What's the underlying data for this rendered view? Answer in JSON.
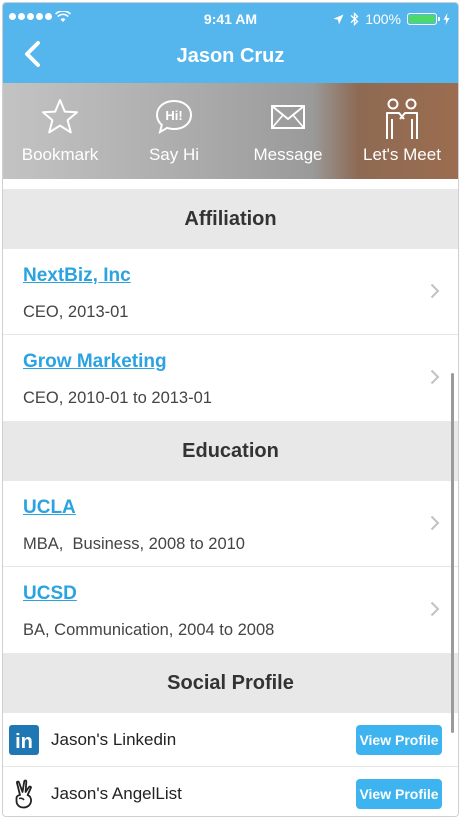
{
  "status_bar": {
    "time": "9:41 AM",
    "battery_pct": "100%"
  },
  "nav": {
    "title": "Jason Cruz"
  },
  "actions": [
    {
      "label": "Bookmark",
      "icon": "star-icon"
    },
    {
      "label": "Say Hi",
      "icon": "say-hi-icon",
      "bubble_text": "Hi!"
    },
    {
      "label": "Message",
      "icon": "envelope-icon"
    },
    {
      "label": "Let's Meet",
      "icon": "handshake-icon"
    }
  ],
  "sections": {
    "affiliation": {
      "title": "Affiliation",
      "items": [
        {
          "name": "NextBiz, Inc",
          "detail": "CEO, 2013-01"
        },
        {
          "name": "Grow Marketing",
          "detail": "CEO, 2010-01 to 2013-01"
        }
      ]
    },
    "education": {
      "title": "Education",
      "items": [
        {
          "name": "UCLA",
          "detail": "MBA,  Business, 2008 to 2010"
        },
        {
          "name": "UCSD",
          "detail": "BA, Communication, 2004 to 2008"
        }
      ]
    },
    "social": {
      "title": "Social Profile",
      "items": [
        {
          "name": "Jason's Linkedin",
          "button": "View Profile",
          "icon": "linkedin-icon",
          "icon_text": "in"
        },
        {
          "name": "Jason's AngelList",
          "button": "View Profile",
          "icon": "angellist-icon"
        }
      ]
    }
  },
  "colors": {
    "accent": "#55b6ee",
    "link": "#2ba3e0",
    "button": "#3db3f0",
    "section_bg": "#e8e8e8"
  }
}
